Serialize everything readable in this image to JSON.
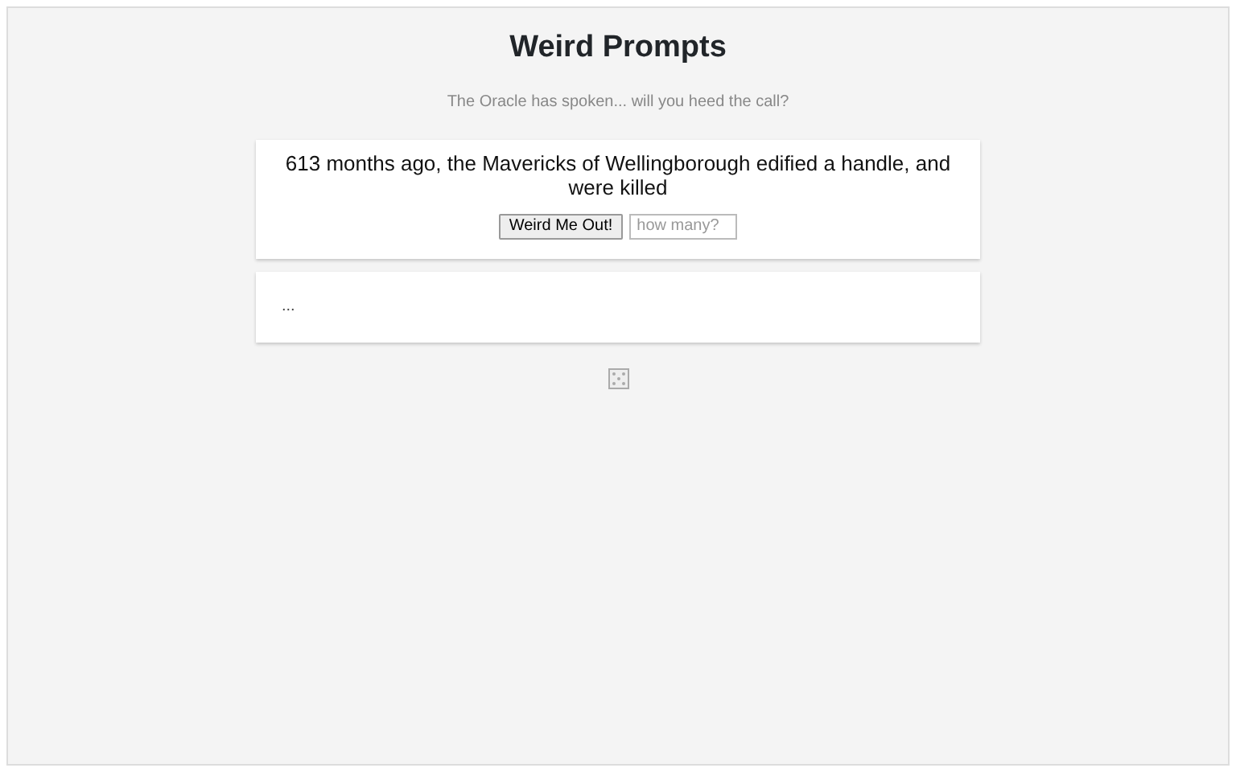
{
  "title": "Weird Prompts",
  "subtitle": "The Oracle has spoken... will you heed the call?",
  "prompt": {
    "text": "613 months ago, the Mavericks of Wellingborough edified a handle, and were killed",
    "button": "Weird Me Out!",
    "count_placeholder": "how many?"
  },
  "output": {
    "text": "..."
  }
}
